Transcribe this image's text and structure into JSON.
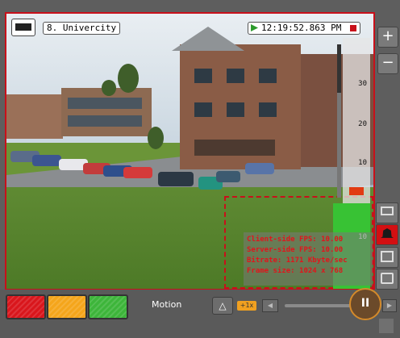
{
  "camera": {
    "name": "8. Univercity",
    "timestamp": "12:19:52.863 PM"
  },
  "stats": {
    "line1": "Client-side FPS: 10.00",
    "line2": "Server-side FPS: 10.00",
    "line3": "Bitrate: 1171 Kbyte/sec",
    "line4": "Frame size: 1024 x 768"
  },
  "meter": {
    "ticks": [
      "30",
      "20",
      "10",
      "10"
    ]
  },
  "zoom": {
    "plus": "+",
    "minus": "−"
  },
  "toolbar": {
    "motion_label": "Motion",
    "speed": "+1x",
    "pause_label": "II"
  },
  "colors": {
    "alarm_red": "#d9161c",
    "alarm_orange": "#f5a51b",
    "alarm_green": "#3db53a",
    "accent": "#c8101a"
  },
  "icons": [
    "camera-icon",
    "play-icon",
    "record-icon",
    "bell-icon",
    "monitor-icon",
    "film-icon",
    "tape-icon",
    "eye-icon",
    "pause-icon"
  ]
}
